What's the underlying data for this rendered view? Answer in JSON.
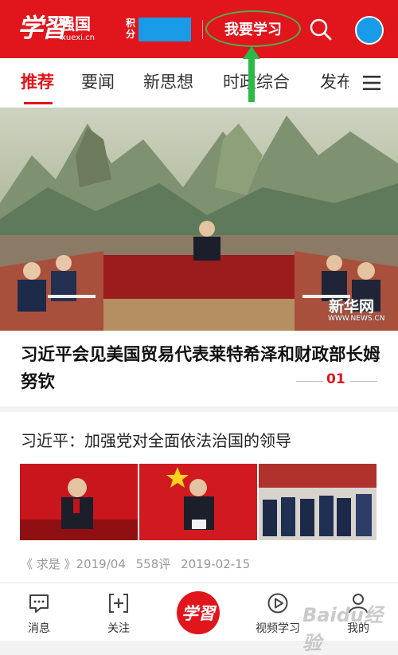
{
  "header": {
    "logo_script": "学習",
    "logo_text": "强国",
    "logo_sub": "xuexi.cn",
    "points_label": "积分",
    "study_button": "我要学习"
  },
  "tabs": [
    "推荐",
    "要闻",
    "新思想",
    "时政综合",
    "发布"
  ],
  "hero": {
    "watermark_cn": "新华网",
    "watermark_en": "WWW.NEWS.CN",
    "headline": "习近平会见美国贸易代表莱特希泽和财政部长姆努钦",
    "index": "01"
  },
  "article": {
    "title": "习近平：加强党对全面依法治国的领导",
    "source": "《 求是 》2019/04",
    "comments": "558评",
    "date": "2019-02-15"
  },
  "bottom_nav": [
    {
      "label": "消息"
    },
    {
      "label": "关注"
    },
    {
      "label": "学習"
    },
    {
      "label": "视频学习"
    },
    {
      "label": "我的"
    }
  ],
  "baidu_watermark": "Baidu经验",
  "colors": {
    "brand_red": "#e0161c",
    "points_blue": "#1a9be8",
    "annotation_green": "#4caf50"
  }
}
